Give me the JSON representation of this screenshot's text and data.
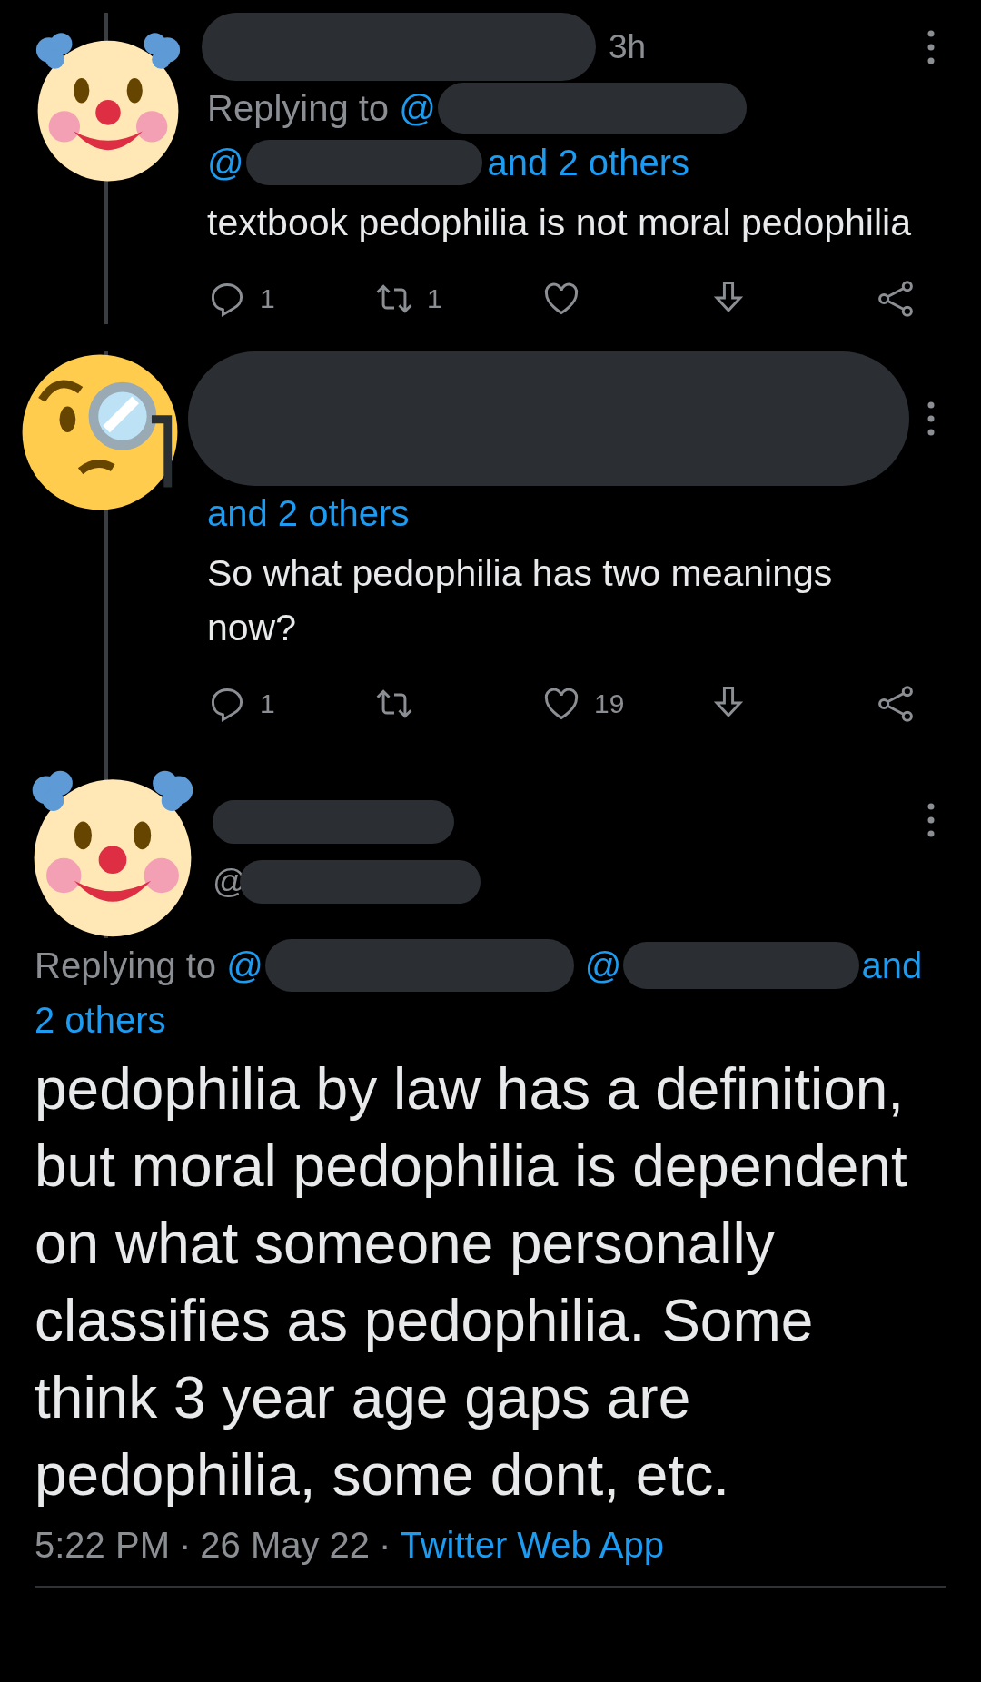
{
  "replies": [
    {
      "avatar": {
        "kind": "clown"
      },
      "time": "3h",
      "replying_label": "Replying to",
      "mention_1": "@",
      "mention_2": "@",
      "others": "and 2 others",
      "text": "textbook pedophilia is not moral pedophilia",
      "actions": [
        {
          "kind": "reply",
          "count": "1"
        },
        {
          "kind": "retweet",
          "count": "1"
        },
        {
          "kind": "like"
        },
        {
          "kind": "download"
        },
        {
          "kind": "share"
        }
      ]
    },
    {
      "avatar": {
        "kind": "monocle"
      },
      "others": "and 2 others",
      "text": "So what pedophilia has two meanings now?",
      "actions": [
        {
          "kind": "reply",
          "count": "1"
        },
        {
          "kind": "retweet"
        },
        {
          "kind": "like",
          "count": "19"
        },
        {
          "kind": "download"
        },
        {
          "kind": "share"
        }
      ]
    }
  ],
  "main_tweet": {
    "avatar": {
      "kind": "clown"
    },
    "handle_prefix": "@",
    "replying_label": "Replying to",
    "mention_1": "@",
    "mention_2": "@",
    "reply_tail": "and",
    "reply_tail_2": "2 others",
    "text": "pedophilia by law has a definition, but moral pedophilia is dependent on what someone personally classifies as pedophilia. Some think 3 year age gaps are pedophilia, some dont, etc.",
    "time": "5:22 PM",
    "separator_1": "·",
    "date": "26 May 22",
    "separator_2": "·",
    "source": "Twitter Web App"
  }
}
